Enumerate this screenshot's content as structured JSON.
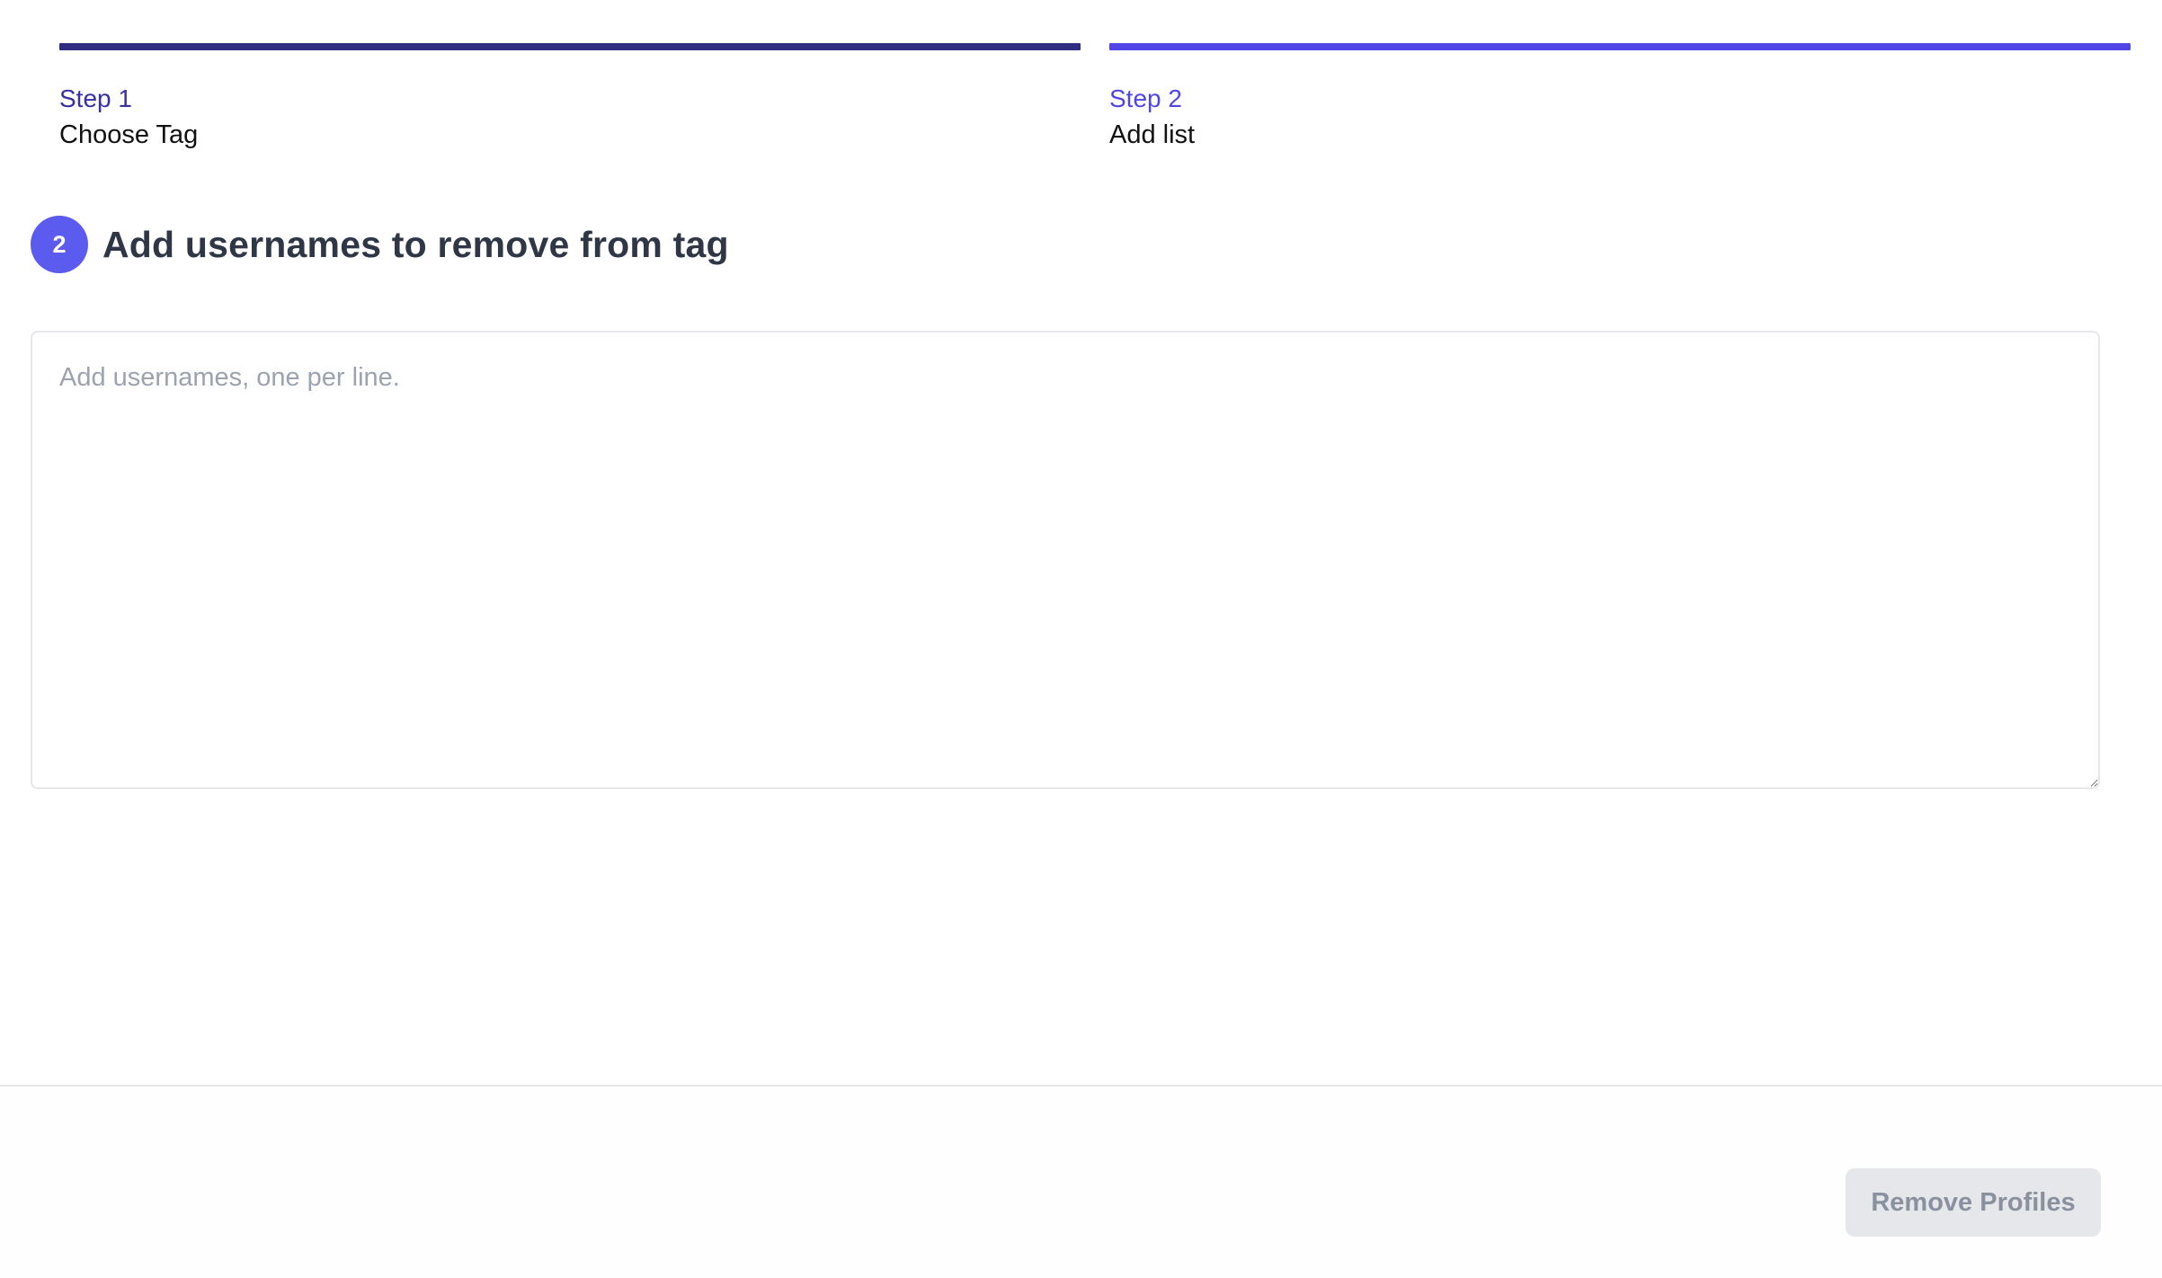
{
  "stepper": {
    "steps": [
      {
        "kicker": "Step 1",
        "title": "Choose Tag",
        "bar_color": "#312e81"
      },
      {
        "kicker": "Step 2",
        "title": "Add list",
        "bar_color": "#4f46e5"
      }
    ]
  },
  "section": {
    "badge_number": "2",
    "title": "Add usernames to remove from tag"
  },
  "usernames_input": {
    "value": "",
    "placeholder": "Add usernames, one per line."
  },
  "footer": {
    "remove_button_label": "Remove Profiles",
    "remove_button_state": "disabled"
  },
  "colors": {
    "accent": "#4f46e5",
    "accent_dark": "#312e81",
    "badge": "#5b5bf0",
    "disabled_button_bg": "#e5e7eb",
    "disabled_button_text": "#8a919e"
  }
}
